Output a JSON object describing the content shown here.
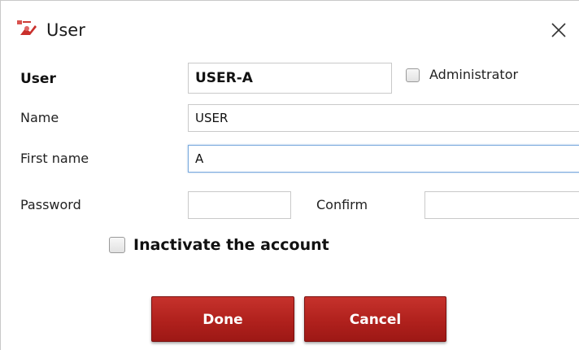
{
  "window": {
    "title": "User"
  },
  "form": {
    "user_label": "User",
    "user_value": "USER-A",
    "administrator_label": "Administrator",
    "administrator_checked": false,
    "name_label": "Name",
    "name_value": "USER",
    "first_name_label": "First name",
    "first_name_value": "A",
    "password_label": "Password",
    "password_value": "",
    "confirm_label": "Confirm",
    "confirm_value": "",
    "inactivate_label": "Inactivate the account",
    "inactivate_checked": false
  },
  "buttons": {
    "done_label": "Done",
    "cancel_label": "Cancel"
  },
  "colors": {
    "button_red": "#b0211d",
    "focus_border": "#79a9dd"
  },
  "icons": {
    "app": "user-edit-icon",
    "close": "close-icon"
  }
}
